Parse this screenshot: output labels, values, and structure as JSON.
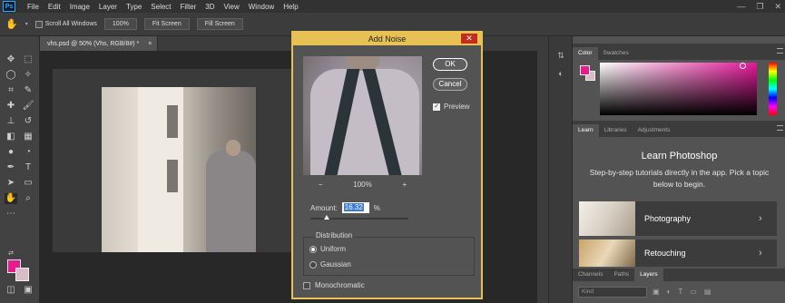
{
  "menubar": {
    "logo": "Ps",
    "items": [
      "File",
      "Edit",
      "Image",
      "Layer",
      "Type",
      "Select",
      "Filter",
      "3D",
      "View",
      "Window",
      "Help"
    ],
    "window_controls": [
      "—",
      "❐",
      "✕"
    ]
  },
  "options_bar": {
    "scroll_all_windows": "Scroll All Windows",
    "zoom_100": "100%",
    "fit_screen": "Fit Screen",
    "fill_screen": "Fill Screen"
  },
  "document": {
    "tab_title": "vhs.psd @ 50% (Vhs, RGB/8#) *",
    "tab_close": "×"
  },
  "dialog": {
    "title": "Add Noise",
    "close": "✕",
    "ok": "OK",
    "cancel": "Cancel",
    "preview_label": "Preview",
    "preview_checked": true,
    "zoom_level": "100%",
    "zoom_out": "−",
    "zoom_in": "+",
    "amount_label": "Amount:",
    "amount_value": "16.32",
    "amount_unit": "%",
    "amount_slider_fraction": 0.1632,
    "distribution_label": "Distribution",
    "uniform_label": "Uniform",
    "gaussian_label": "Gaussian",
    "selected_distribution": "Uniform",
    "monochromatic_label": "Monochromatic",
    "monochromatic_checked": false
  },
  "color_panel": {
    "tabs": [
      "Color",
      "Swatches"
    ],
    "foreground": "#e81a8c",
    "background": "#d9bcc6"
  },
  "learn_panel": {
    "tabs": [
      "Learn",
      "Libraries",
      "Adjustments"
    ],
    "title": "Learn Photoshop",
    "subtitle": "Step-by-step tutorials directly in the app. Pick a topic below to begin.",
    "cards": [
      {
        "label": "Photography",
        "arrow": "›"
      },
      {
        "label": "Retouching",
        "arrow": "›"
      }
    ]
  },
  "layers_panel": {
    "tabs": [
      "Channels",
      "Paths",
      "Layers"
    ],
    "search_placeholder": "Kind"
  },
  "colors": {
    "dialog_accent": "#e8c154",
    "foreground_swatch": "#e81a8c",
    "background_swatch": "#d9bcc6"
  }
}
